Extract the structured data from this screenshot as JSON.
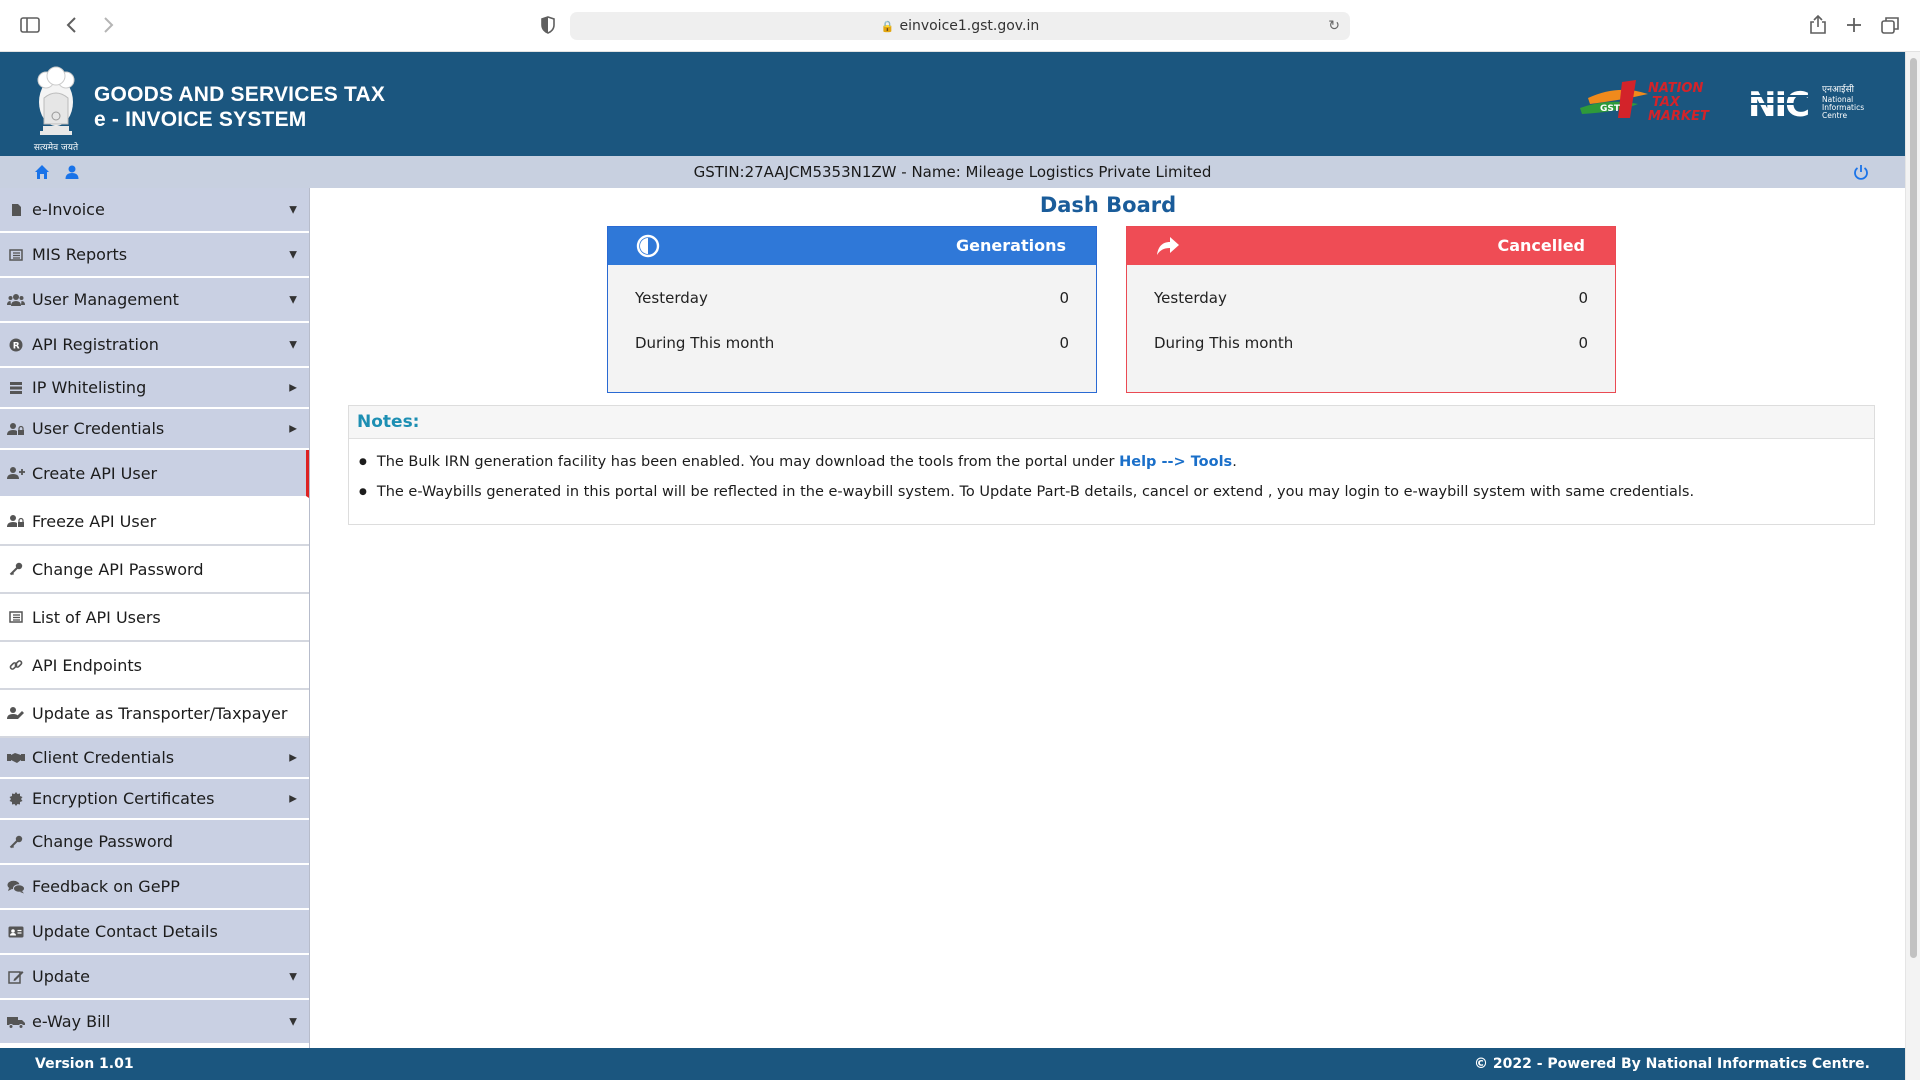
{
  "browser": {
    "url": "einvoice1.gst.gov.in"
  },
  "header": {
    "title_line1": "GOODS AND SERVICES TAX",
    "title_line2": "e - INVOICE SYSTEM",
    "emblem_caption": "सत्यमेव जयते",
    "partner_logo_text": "NATION TAX MARKET",
    "nic_logo_text": "NIC",
    "nic_hindi": "एनआईसी",
    "nic_sub": [
      "National",
      "Informatics",
      "Centre"
    ]
  },
  "infobar": {
    "gstin_text": "GSTIN:27AAJCM5353N1ZW - Name: Mileage Logistics Private Limited"
  },
  "sidebar": {
    "items": [
      {
        "label": "e-Invoice",
        "icon": "file-icon",
        "caret": "down",
        "height": 45
      },
      {
        "label": "MIS Reports",
        "icon": "list-icon",
        "caret": "down",
        "height": 45
      },
      {
        "label": "User Management",
        "icon": "users-icon",
        "caret": "down",
        "height": 45
      },
      {
        "label": "API Registration",
        "icon": "registered-icon",
        "caret": "down",
        "height": 45
      },
      {
        "label": "IP Whitelisting",
        "icon": "server-icon",
        "caret": "right",
        "height": 41
      },
      {
        "label": "User Credentials",
        "icon": "user-lock-icon",
        "caret": "right",
        "height": 41
      },
      {
        "label": "Create API User",
        "icon": "user-plus-icon",
        "caret": "none",
        "height": 48
      },
      {
        "label": "Freeze API User",
        "icon": "user-lock-icon",
        "caret": "none",
        "height": 48
      },
      {
        "label": "Change API Password",
        "icon": "key-icon",
        "caret": "none",
        "height": 48
      },
      {
        "label": "List of API Users",
        "icon": "list-icon",
        "caret": "none",
        "height": 48
      },
      {
        "label": "API Endpoints",
        "icon": "link-icon",
        "caret": "none",
        "height": 48
      },
      {
        "label": "Update as Transporter/Taxpayer",
        "icon": "user-edit-icon",
        "caret": "none",
        "height": 48
      },
      {
        "label": "Client Credentials",
        "icon": "handshake-icon",
        "caret": "right",
        "height": 41
      },
      {
        "label": "Encryption Certificates",
        "icon": "certificate-icon",
        "caret": "right",
        "height": 41
      },
      {
        "label": "Change Password",
        "icon": "key-icon",
        "caret": "none",
        "height": 45
      },
      {
        "label": "Feedback on GePP",
        "icon": "comments-icon",
        "caret": "none",
        "height": 45
      },
      {
        "label": "Update Contact Details",
        "icon": "id-card-icon",
        "caret": "none",
        "height": 45
      },
      {
        "label": "Update",
        "icon": "edit-icon",
        "caret": "down",
        "height": 45
      },
      {
        "label": "e-Way Bill",
        "icon": "truck-icon",
        "caret": "down",
        "height": 45
      }
    ]
  },
  "main": {
    "title": "Dash Board",
    "generations": {
      "title": "Generations",
      "yesterday_label": "Yesterday",
      "yesterday_value": "0",
      "month_label": "During This month",
      "month_value": "0"
    },
    "cancelled": {
      "title": "Cancelled",
      "yesterday_label": "Yesterday",
      "yesterday_value": "0",
      "month_label": "During This month",
      "month_value": "0"
    },
    "notes": {
      "heading": "Notes:",
      "note1_text": "The Bulk IRN generation facility has been enabled. You may download the tools from the portal under ",
      "note1_link": "Help --> Tools",
      "note1_end": ".",
      "note2_text": "The e-Waybills generated in this portal will be reflected in the e-waybill system. To Update Part-B details, cancel or extend , you may login to e-waybill system with same credentials."
    }
  },
  "footer": {
    "version": "Version 1.01",
    "copyright": "© 2022 - Powered By National Informatics Centre."
  }
}
